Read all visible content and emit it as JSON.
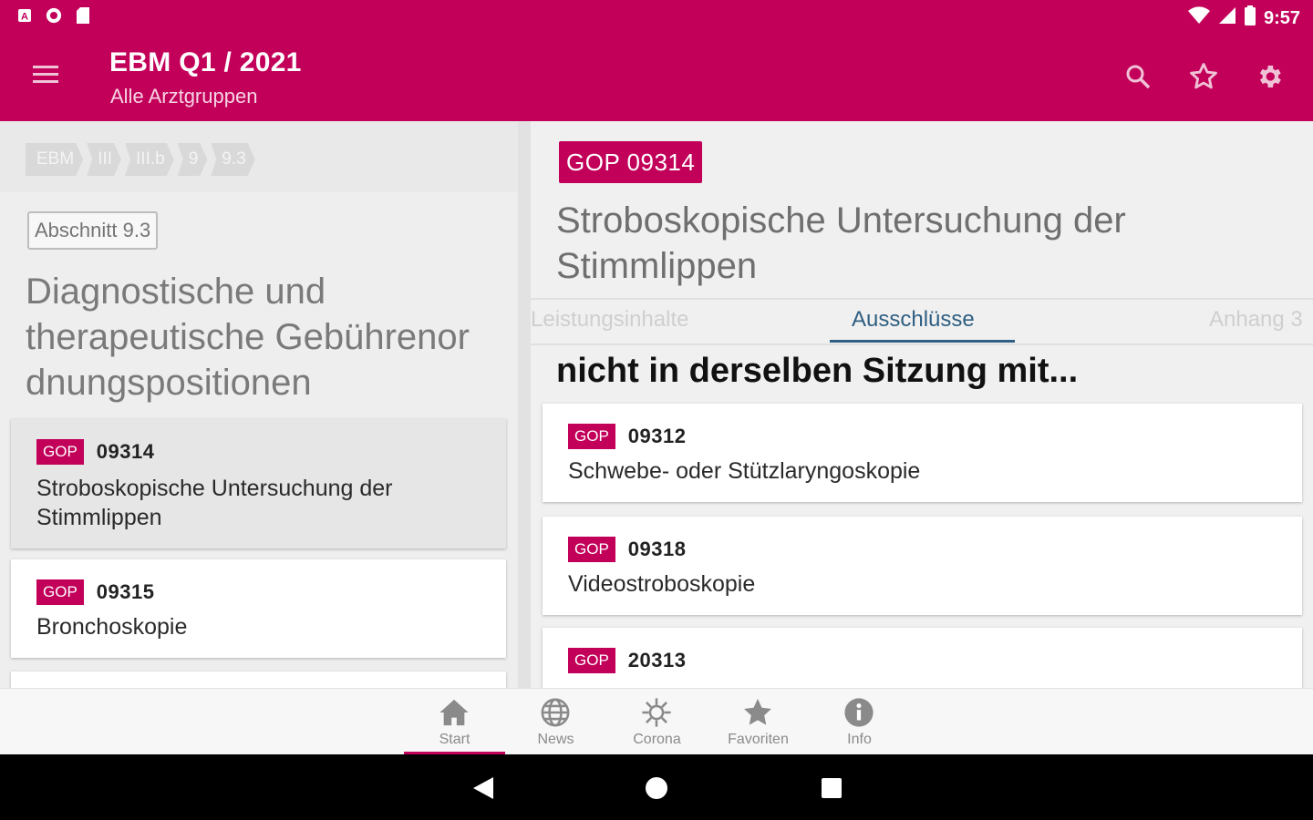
{
  "status_bar": {
    "time": "9:57",
    "left_icons": [
      "a-notification-icon",
      "circle-notification-icon",
      "sd-card-icon"
    ],
    "right_icons": [
      "wifi-icon",
      "signal-icon",
      "battery-icon"
    ]
  },
  "app_bar": {
    "title": "EBM Q1 / 2021",
    "subtitle": "Alle Arztgruppen",
    "actions": [
      "search-icon",
      "star-outline-icon",
      "gear-icon"
    ]
  },
  "left": {
    "breadcrumbs": [
      "EBM",
      "III",
      "III.b",
      "9",
      "9.3"
    ],
    "section_tag": "Abschnitt 9.3",
    "section_title": "Diagnostische und therapeutische Gebührenor dnungspositionen",
    "items": [
      {
        "badge": "GOP",
        "code": "09314",
        "title": "Stroboskopische Untersuchung der Stimmlippen"
      },
      {
        "badge": "GOP",
        "code": "09315",
        "title": "Bronchoskopie"
      }
    ]
  },
  "right": {
    "badge": "GOP 09314",
    "title": "Stroboskopische Untersuchung der Stimmlippen",
    "tabs": [
      "Leistungsinhalte",
      "Ausschlüsse",
      "Anhang 3"
    ],
    "active_tab": "Ausschlüsse",
    "heading": "nicht in derselben Sitzung mit...",
    "items": [
      {
        "badge": "GOP",
        "code": "09312",
        "title": "Schwebe- oder Stützlaryngoskopie"
      },
      {
        "badge": "GOP",
        "code": "09318",
        "title": "Videostroboskopie"
      },
      {
        "badge": "GOP",
        "code": "20313",
        "title": ""
      }
    ]
  },
  "bottom_nav": {
    "items": [
      {
        "label": "Start",
        "icon": "home-icon"
      },
      {
        "label": "News",
        "icon": "globe-icon"
      },
      {
        "label": "Corona",
        "icon": "virus-icon"
      },
      {
        "label": "Favoriten",
        "icon": "star-icon"
      },
      {
        "label": "Info",
        "icon": "info-icon"
      }
    ],
    "active": "Start"
  },
  "colors": {
    "brand": "#c2005a",
    "tab_active": "#2f5f82"
  }
}
